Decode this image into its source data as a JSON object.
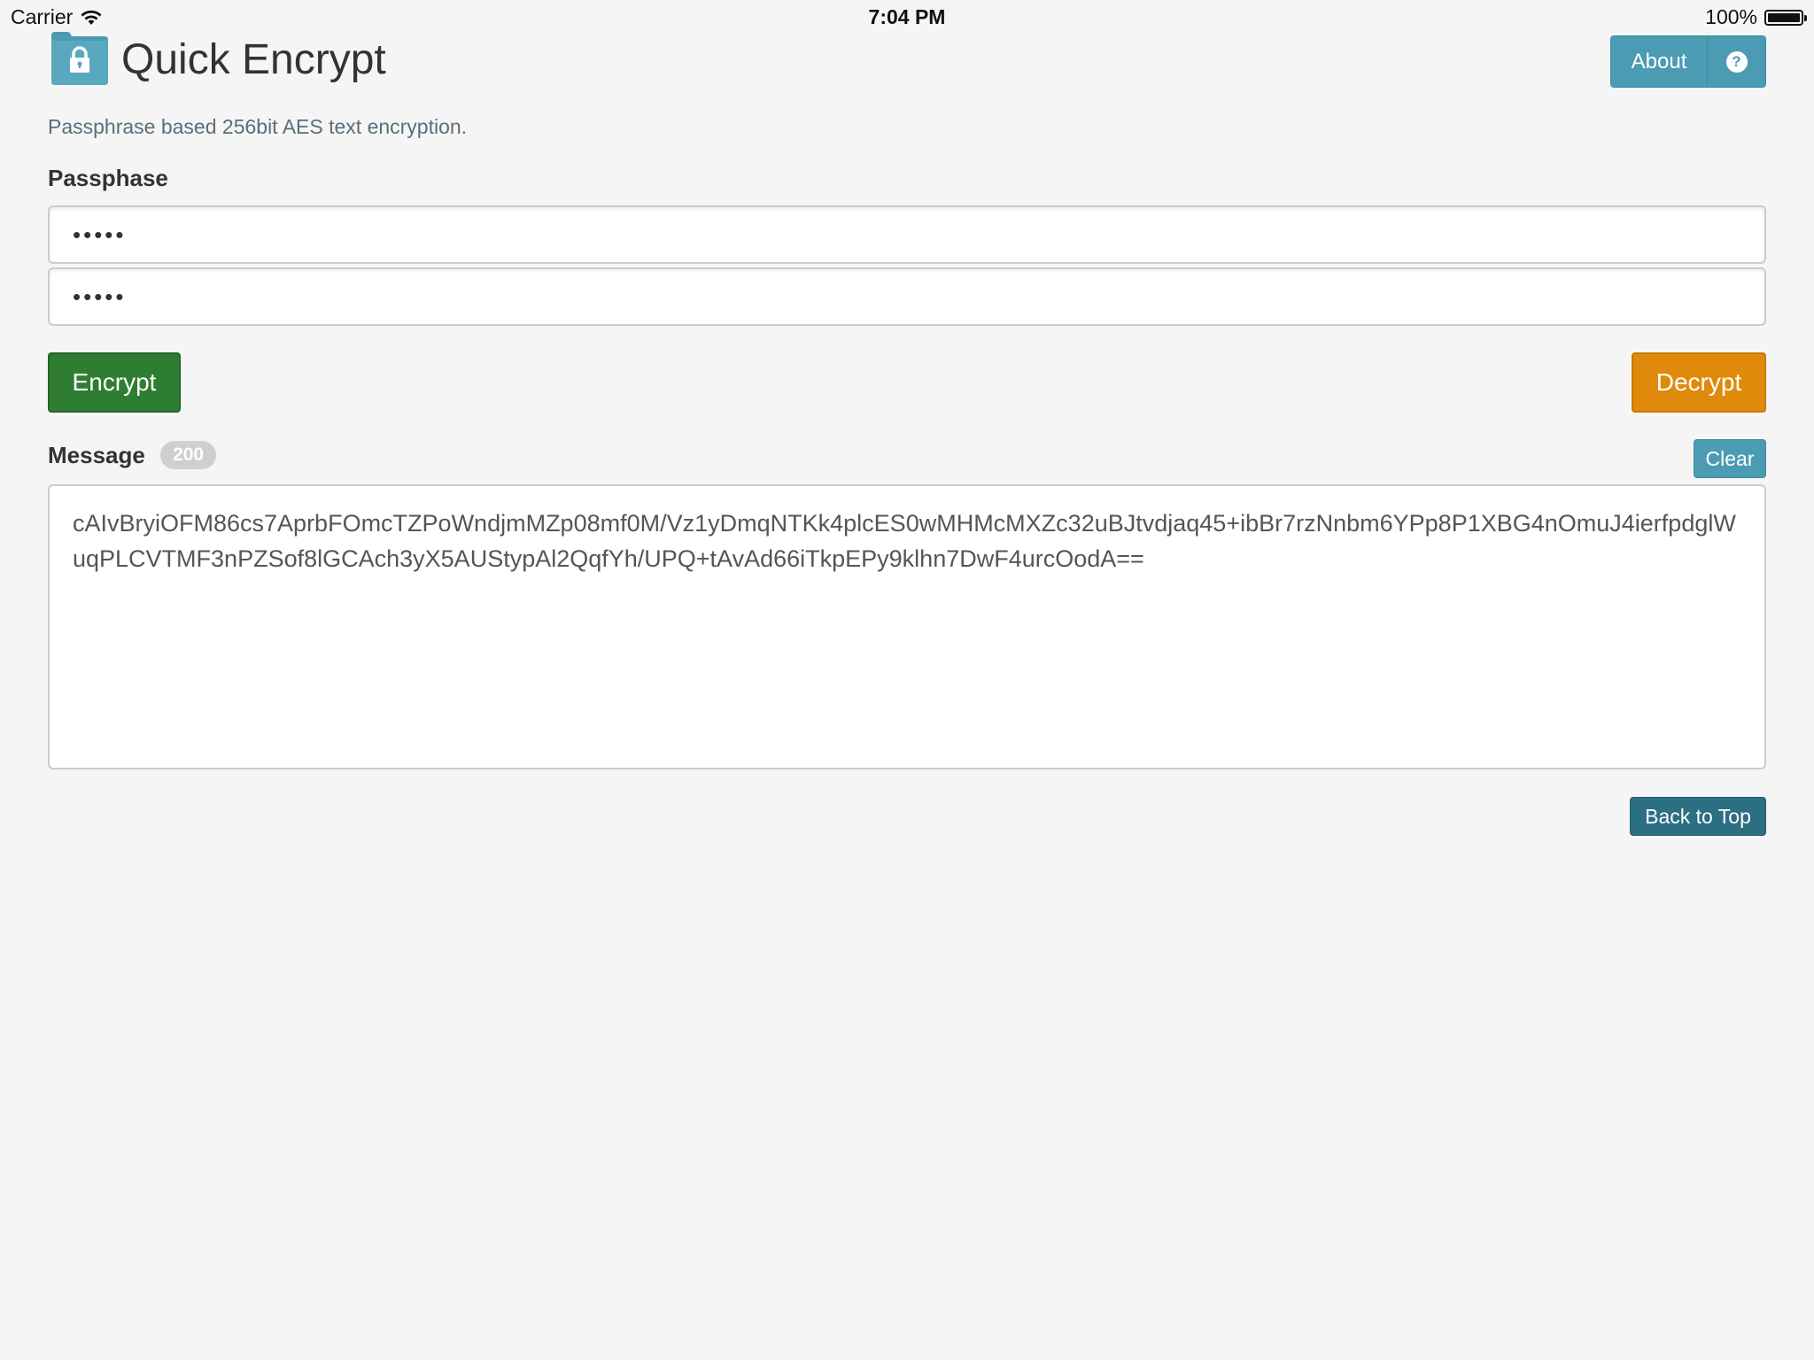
{
  "status_bar": {
    "carrier": "Carrier",
    "time": "7:04 PM",
    "battery": "100%",
    "battery_level": 1.0
  },
  "header": {
    "title": "Quick Encrypt",
    "logo_icon": "lock-icon",
    "about_label": "About",
    "help_icon": "question-circle-icon",
    "help_glyph": "?"
  },
  "subtitle": "Passphrase based 256bit AES text encryption.",
  "passphrase": {
    "label": "Passphase",
    "field1_value": "•••••",
    "field2_value": "•••••"
  },
  "actions": {
    "encrypt_label": "Encrypt",
    "decrypt_label": "Decrypt"
  },
  "message": {
    "label": "Message",
    "count_badge": "200",
    "clear_label": "Clear",
    "value": "cAIvBryiOFM86cs7AprbFOmcTZPoWndjmMZp08mf0M/Vz1yDmqNTKk4plcES0wMHMcMXZc32uBJtvdjaq45+ibBr7rzNnbm6YPp8P1XBG4nOmuJ4ierfpdglWuqPLCVTMF3nPZSof8lGCAch3yX5AUStypAl2QqfYh/UPQ+tAvAd66iTkpEPy9klhn7DwF4urcOodA=="
  },
  "footer": {
    "back_to_top_label": "Back to Top"
  },
  "colors": {
    "background": "#f5f5f5",
    "info": "#4b9bb3",
    "success": "#2f7d32",
    "warning": "#e08a0b",
    "primary_dark": "#2c6e82"
  }
}
